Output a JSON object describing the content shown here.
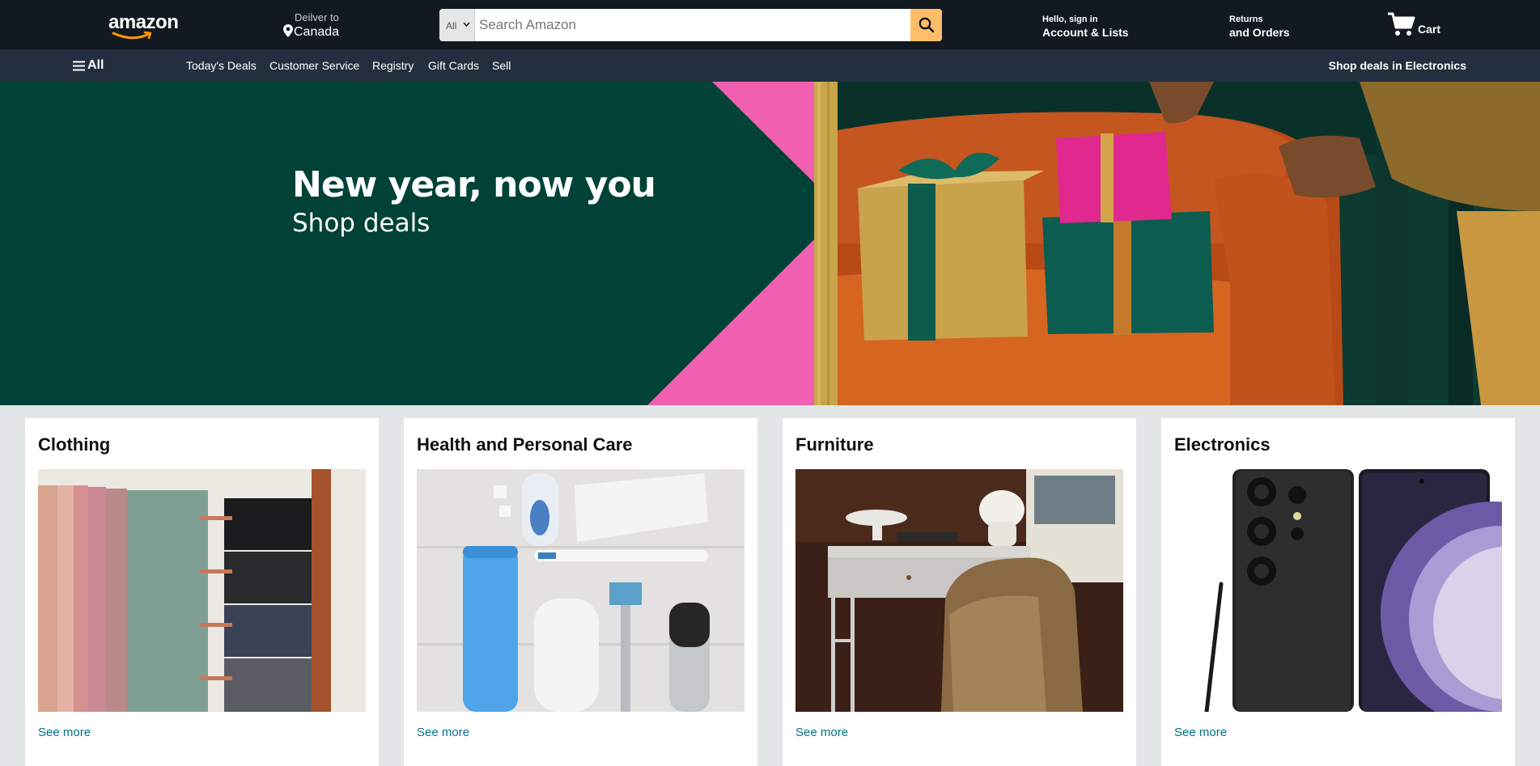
{
  "header": {
    "logo_text": "amazon",
    "deliver_line1": "Deilver to",
    "deliver_line2": "Canada",
    "search_category": "All",
    "search_placeholder": "Search Amazon",
    "account_line1": "Hello, sign in",
    "account_line2": "Account & Lists",
    "returns_line1": "Returns",
    "returns_line2": "and Orders",
    "cart_label": "Cart"
  },
  "subnav": {
    "all_label": "All",
    "links": [
      "Today's Deals",
      "Customer Service",
      "Registry",
      "Gift Cards",
      "Sell"
    ],
    "promo": "Shop deals in Electronics"
  },
  "hero": {
    "title": "New year, now you",
    "subtitle": "Shop deals"
  },
  "cards": [
    {
      "title": "Clothing",
      "link": "See more"
    },
    {
      "title": "Health and Personal Care",
      "link": "See more"
    },
    {
      "title": "Furniture",
      "link": "See more"
    },
    {
      "title": "Electronics",
      "link": "See more"
    }
  ],
  "colors": {
    "header_bg": "#131921",
    "subnav_bg": "#232f3e",
    "search_button": "#febd69",
    "hero_bg": "#004237",
    "hero_pink": "#f15fb0",
    "link": "#007185"
  }
}
